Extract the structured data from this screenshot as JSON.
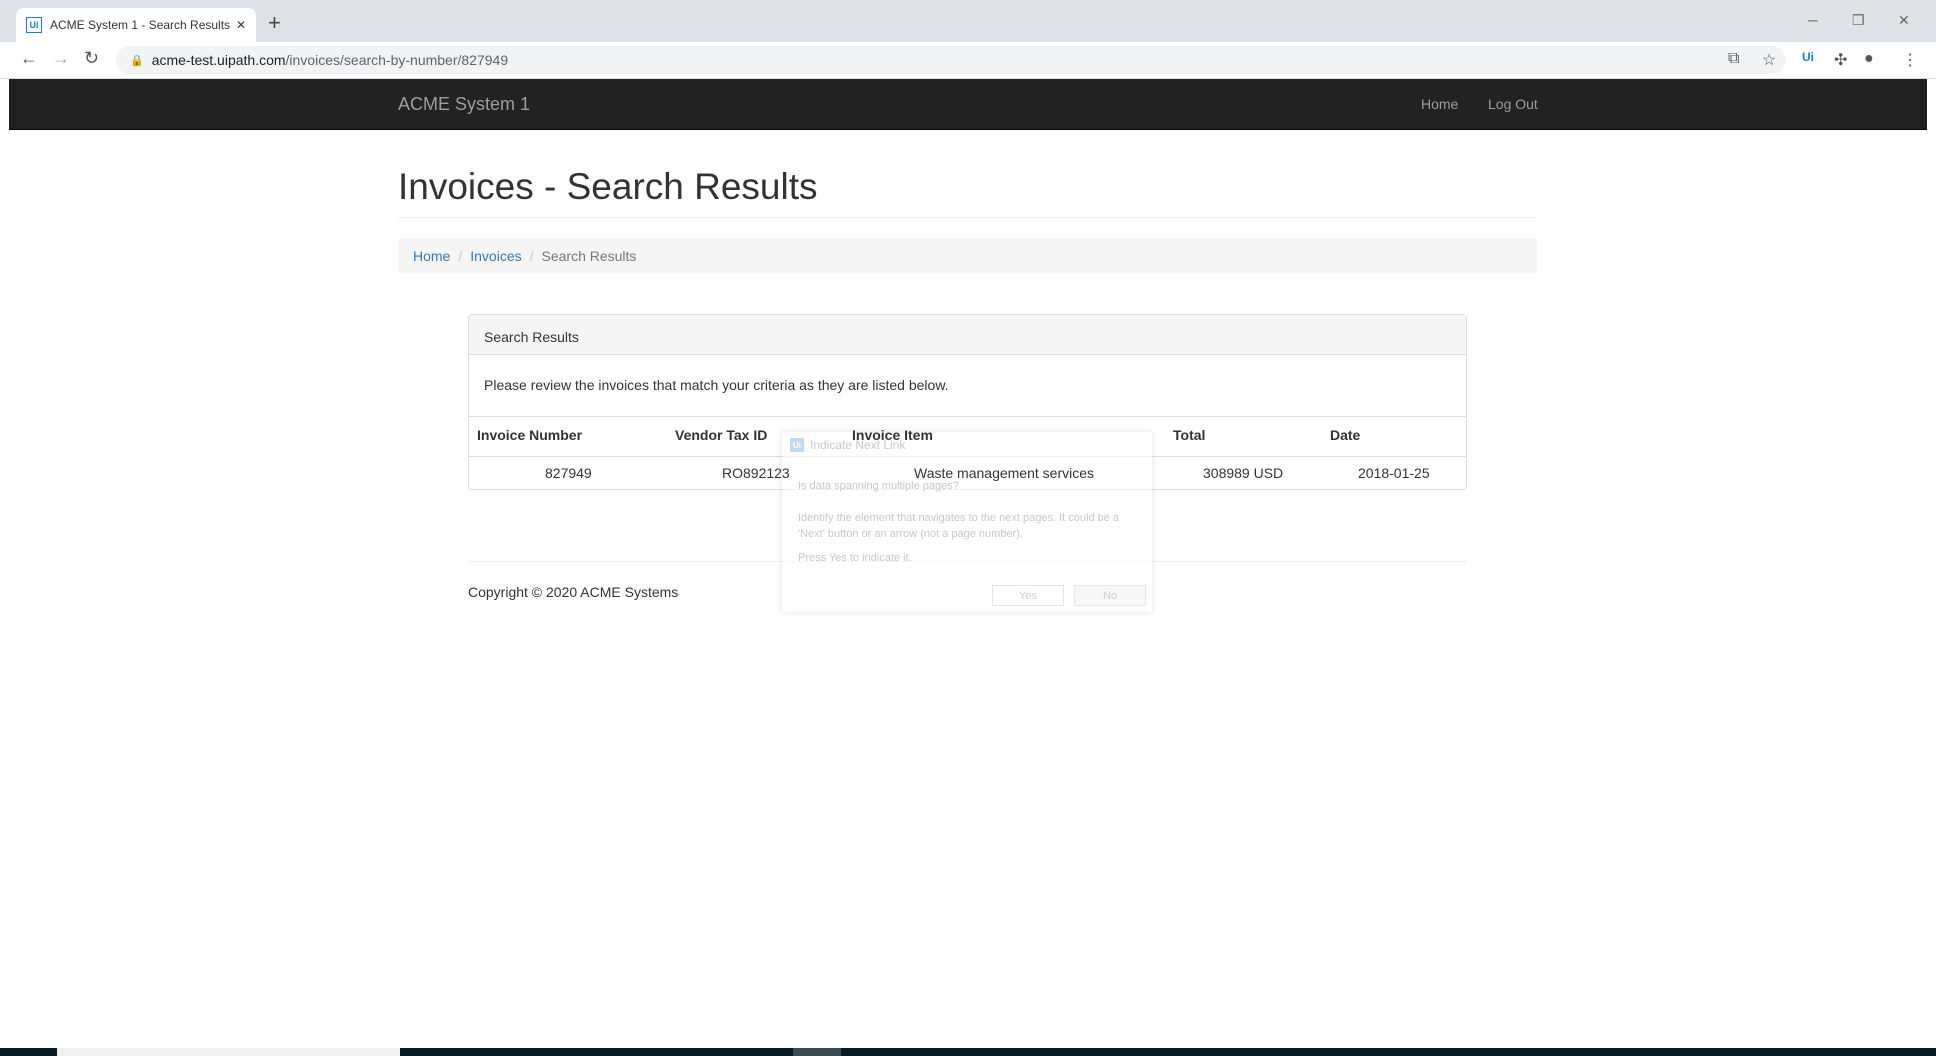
{
  "browser": {
    "tab_title": "ACME System 1 - Search Results",
    "tab_icon": "uipath-logo",
    "url_host": "acme-test.uipath.com",
    "url_path": "/invoices/search-by-number/827949"
  },
  "nav": {
    "brand": "ACME System 1",
    "home": "Home",
    "logout": "Log Out"
  },
  "page": {
    "title": "Invoices - Search Results"
  },
  "breadcrumb": [
    "Home",
    "Invoices",
    "Search Results"
  ],
  "panel": {
    "heading": "Search Results",
    "body": "Please review the invoices that match your criteria as they are listed below.",
    "columns": [
      "Invoice Number",
      "Vendor Tax ID",
      "Invoice Item",
      "Total",
      "Date"
    ],
    "rows": [
      [
        "827949",
        "RO892123",
        "Waste management services",
        "308989 USD",
        "2018-01-25"
      ]
    ]
  },
  "footer": {
    "copyright": "Copyright © 2020 ACME Systems"
  },
  "dialog": {
    "title": "Indicate Next Link",
    "question": "Is data spanning multiple pages?",
    "desc": "Identify the element that navigates to the next pages. It could be a 'Next' button or an arrow (not a page number).",
    "hint": "Press Yes to indicate it.",
    "yes": "Yes",
    "no": "No"
  }
}
